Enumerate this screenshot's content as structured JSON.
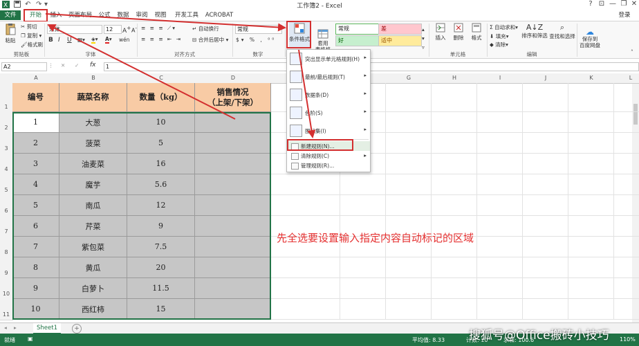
{
  "window": {
    "title": "工作簿2 - Excel",
    "login": "登录",
    "help": "?",
    "min": "—",
    "restore": "❐",
    "close": "✕"
  },
  "tabs": [
    "文件",
    "开始",
    "插入",
    "页面布局",
    "公式",
    "数据",
    "审阅",
    "视图",
    "开发工具",
    "ACROBAT"
  ],
  "ribbon": {
    "clipboard": {
      "paste": "粘贴",
      "cut": "剪切",
      "copy": "复制",
      "format_painter": "格式刷",
      "label": "剪贴板"
    },
    "font": {
      "name": "宋体",
      "size": "12",
      "grow": "A",
      "shrink": "A",
      "bold": "B",
      "italic": "I",
      "underline": "U",
      "phonetic": "wén",
      "label": "字体"
    },
    "alignment": {
      "wrap": "自动换行",
      "merge": "合并后居中",
      "label": "对齐方式"
    },
    "number": {
      "format": "常规",
      "label": "数字"
    },
    "styles": {
      "conditional": "条件格式",
      "table_format": "套用\n表格格式",
      "normal": "常规",
      "bad": "差",
      "good": "好",
      "neutral": "适中"
    },
    "cells": {
      "insert": "插入",
      "delete": "删除",
      "format": "格式",
      "label": "单元格"
    },
    "editing": {
      "autosum": "自动求和",
      "fill": "填充",
      "clear": "清除",
      "sort": "排序和筛选",
      "find": "查找和选择",
      "label": "编辑"
    },
    "save": {
      "label": "保存到\n百度网盘"
    }
  },
  "formula_bar": {
    "name_box": "A2",
    "fx": "fx",
    "value": "1"
  },
  "columns": [
    "A",
    "B",
    "C",
    "D",
    "E",
    "F",
    "G",
    "H",
    "I",
    "J",
    "K",
    "L"
  ],
  "rows": [
    "1",
    "2",
    "3",
    "4",
    "5",
    "6",
    "7",
    "8",
    "9",
    "10",
    "11"
  ],
  "table": {
    "headers": [
      "编号",
      "蔬菜名称",
      "数量（kg）",
      "销售情况\n（上架/下架）"
    ],
    "rows": [
      [
        "1",
        "大葱",
        "10",
        ""
      ],
      [
        "2",
        "菠菜",
        "5",
        ""
      ],
      [
        "3",
        "油麦菜",
        "16",
        ""
      ],
      [
        "4",
        "魔芋",
        "5.6",
        ""
      ],
      [
        "5",
        "南瓜",
        "12",
        ""
      ],
      [
        "6",
        "芹菜",
        "9",
        ""
      ],
      [
        "7",
        "紫包菜",
        "7.5",
        ""
      ],
      [
        "8",
        "黄瓜",
        "20",
        ""
      ],
      [
        "9",
        "白萝卜",
        "11.5",
        ""
      ],
      [
        "10",
        "西红柿",
        "15",
        ""
      ]
    ]
  },
  "cf_menu": {
    "items": [
      {
        "label": "突出显示单元格规则(H)",
        "icon": "highlight-rules-icon"
      },
      {
        "label": "最前/最后规则(T)",
        "icon": "top-bottom-icon"
      },
      {
        "label": "数据条(D)",
        "icon": "data-bars-icon"
      },
      {
        "label": "色阶(S)",
        "icon": "color-scales-icon"
      },
      {
        "label": "图标集(I)",
        "icon": "icon-sets-icon"
      }
    ],
    "sub_items": [
      "新建规则(N)...",
      "清除规则(C)",
      "管理规则(R)..."
    ]
  },
  "annotation": "先全选要设置输入指定内容自动标记的区域",
  "sheet": {
    "tab": "Sheet1",
    "add": "+"
  },
  "status": {
    "ready": "就绪",
    "average": "平均值: 8.33",
    "count": "计数: 10",
    "sum": "求和: 100.6",
    "zoom": "110%"
  },
  "watermark": "搜狐号@Office搬砖小技巧",
  "colors": {
    "excel_green": "#217346",
    "header_fill": "#f8cba5",
    "selection_fill": "#c6c6c6",
    "annotation_red": "#d32f2f",
    "bad_fill": "#ffc7ce",
    "good_fill": "#c6efce",
    "neutral_fill": "#ffeb9c"
  }
}
